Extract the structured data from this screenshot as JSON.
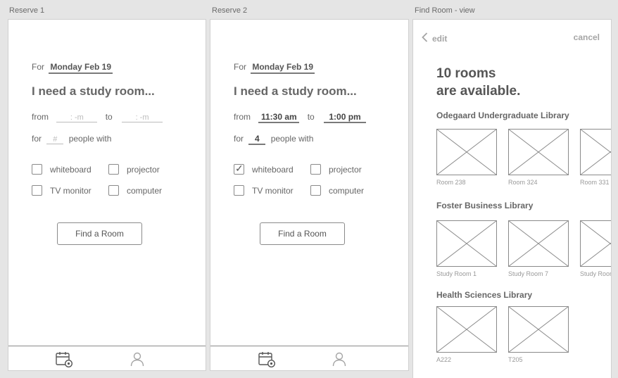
{
  "artboards": {
    "reserve1": "Reserve 1",
    "reserve2": "Reserve 2",
    "find_room": "Find Room - view"
  },
  "reserve1": {
    "for_label": "For",
    "date": "Monday Feb 19",
    "heading": "I need a study room...",
    "from_label": "from",
    "from_placeholder": ":      -m",
    "to_label": "to",
    "to_placeholder": ":      -m",
    "people_for_label": "for",
    "people_placeholder": "#",
    "people_with_label": "people with",
    "options": [
      {
        "label": "whiteboard",
        "checked": false
      },
      {
        "label": "projector",
        "checked": false
      },
      {
        "label": "TV monitor",
        "checked": false
      },
      {
        "label": "computer",
        "checked": false
      }
    ],
    "button": "Find a Room"
  },
  "reserve2": {
    "for_label": "For",
    "date": "Monday Feb 19",
    "heading": "I need a study room...",
    "from_label": "from",
    "from_value": "11:30 am",
    "to_label": "to",
    "to_value": "1:00 pm",
    "people_for_label": "for",
    "people_value": "4",
    "people_with_label": "people with",
    "options": [
      {
        "label": "whiteboard",
        "checked": true
      },
      {
        "label": "projector",
        "checked": false
      },
      {
        "label": "TV monitor",
        "checked": false
      },
      {
        "label": "computer",
        "checked": false
      }
    ],
    "button": "Find a Room"
  },
  "tabbar": {
    "icons": [
      "calendar-add-icon",
      "user-icon"
    ]
  },
  "find_room": {
    "back_icon": "chevron-left-icon",
    "edit": "edit",
    "cancel": "cancel",
    "available_line1": "10 rooms",
    "available_line2": "are available.",
    "libraries": [
      {
        "name": "Odegaard Undergraduate Library",
        "rooms": [
          "Room 238",
          "Room 324",
          "Room 331"
        ]
      },
      {
        "name": "Foster Business Library",
        "rooms": [
          "Study Room 1",
          "Study Room 7",
          "Study Room"
        ]
      },
      {
        "name": "Health Sciences Library",
        "rooms": [
          "A222",
          "T205"
        ]
      }
    ]
  },
  "colors": {
    "canvas": "#e5e5e5",
    "frame": "#ffffff",
    "wire_stroke": "#8a8a8a"
  }
}
